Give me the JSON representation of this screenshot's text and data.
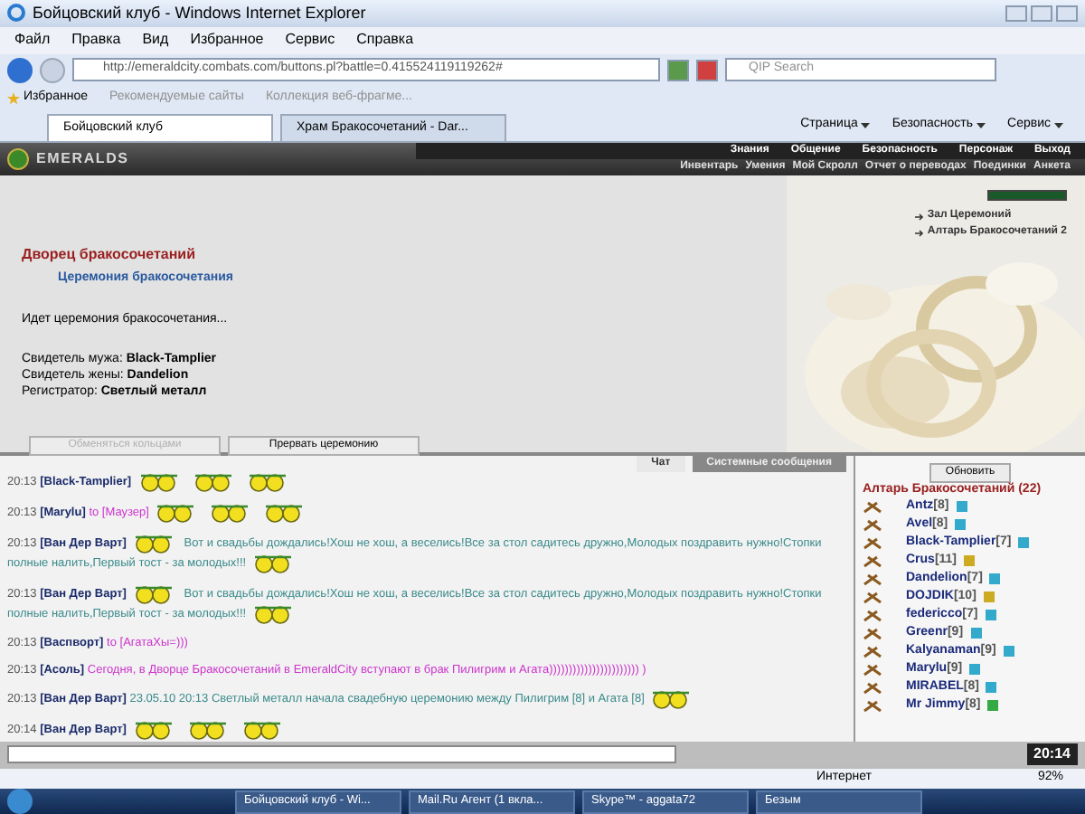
{
  "window": {
    "title": "Бойцовский клуб - Windows Internet Explorer"
  },
  "menu": [
    "Файл",
    "Правка",
    "Вид",
    "Избранное",
    "Сервис",
    "Справка"
  ],
  "address": {
    "value": "http://emeraldcity.combats.com/buttons.pl?battle=0.415524119119262#"
  },
  "search": {
    "placeholder": "QIP Search"
  },
  "favorites": {
    "label": "Избранное",
    "links": [
      "Рекомендуемые сайты",
      "Коллекция веб-фрагме..."
    ]
  },
  "tabs": [
    {
      "label": "Бойцовский клуб",
      "selected": true
    },
    {
      "label": "Храм Бракосочетаний - Dar...",
      "selected": false
    }
  ],
  "command_bar": [
    "Страница",
    "Безопасность",
    "Сервис"
  ],
  "game": {
    "logo": "EMERALDS",
    "nav_top": [
      "Знания",
      "Общение",
      "Безопасность",
      "Персонаж",
      "Выход"
    ],
    "nav_bottom": [
      "Инвентарь",
      "Умения",
      "Мой Скролл",
      "Отчет о переводах",
      "Поединки",
      "Анкета"
    ],
    "title": "Дворец бракосочетаний",
    "subtitle": "Церемония бракосочетания",
    "status": "Идет церемония бракосочетания...",
    "fields": [
      {
        "label": "Свидетель мужа:",
        "value": "Black-Tamplier"
      },
      {
        "label": "Свидетель жены:",
        "value": "Dandelion"
      },
      {
        "label": "Регистратор:",
        "value": "Светлый металл"
      }
    ],
    "buttons": [
      {
        "label": "Обменяться кольцами",
        "disabled": true
      },
      {
        "label": "Прервать церемонию",
        "disabled": false
      }
    ],
    "links": [
      "Зал Церемоний",
      "Алтарь Бракосочетаний 2"
    ]
  },
  "chat": {
    "tabs": [
      {
        "label": "Чат",
        "selected": true
      },
      {
        "label": "Системные сообщения",
        "selected": false
      }
    ],
    "messages": [
      {
        "time": "20:13",
        "from": "[Black-Tamplier]",
        "parts": [
          {
            "kind": "smiley"
          },
          {
            "kind": "smiley"
          },
          {
            "kind": "smiley"
          }
        ]
      },
      {
        "time": "20:13",
        "from": "[Marylu]",
        "to": "to [Маузер]",
        "parts": [
          {
            "kind": "smiley"
          },
          {
            "kind": "smiley"
          },
          {
            "kind": "smiley"
          }
        ]
      },
      {
        "time": "20:13",
        "from": "[Ван Дер Варт]",
        "parts": [
          {
            "kind": "smiley"
          },
          {
            "kind": "text",
            "text": "Вот и свадьбы дождались!Хош не хош, а веселись!Все за стол садитесь дружно,Молодых поздравить нужно!Стопки полные налить,Первый тост - за молодых!!!"
          },
          {
            "kind": "smiley"
          }
        ]
      },
      {
        "time": "20:13",
        "from": "[Ван Дер Варт]",
        "parts": [
          {
            "kind": "smiley"
          },
          {
            "kind": "text",
            "text": "Вот и свадьбы дождались!Хош не хош, а веселись!Все за стол садитесь дружно,Молодых поздравить нужно!Стопки полные налить,Первый тост - за молодых!!!"
          },
          {
            "kind": "smiley"
          }
        ]
      },
      {
        "time": "20:13",
        "from": "[Васпворт]",
        "to": "to [АгатаХы=)))"
      },
      {
        "time": "20:13",
        "from": "[Асоль]",
        "parts": [
          {
            "kind": "magenta",
            "text": "Сегодня, в Дворце Бракосочетаний в EmeraldCity вступают в брак Пилигрим и Агата))))))))))))))))))))))) )"
          }
        ]
      },
      {
        "time": "20:13",
        "from": "[Ван Дер Варт]",
        "parts": [
          {
            "kind": "text",
            "text": "23.05.10 20:13 Светлый металл начала свадебную церемонию между Пилигрим [8] и Агата [8]"
          },
          {
            "kind": "smiley"
          }
        ]
      },
      {
        "time": "20:14",
        "from": "[Ван Дер Варт]",
        "parts": [
          {
            "kind": "smiley"
          },
          {
            "kind": "smiley"
          },
          {
            "kind": "smiley"
          }
        ]
      }
    ]
  },
  "room": {
    "refresh": "Обновить",
    "title": "Алтарь Бракосочетаний (22)",
    "players": [
      {
        "name": "Antz",
        "level": "[8]",
        "color": "#33aacc"
      },
      {
        "name": "Avel",
        "level": "[8]",
        "color": "#33aacc"
      },
      {
        "name": "Black-Tamplier",
        "level": "[7]",
        "color": "#33aacc"
      },
      {
        "name": "Crus",
        "level": "[11]",
        "color": "#ccaa22"
      },
      {
        "name": "Dandelion",
        "level": "[7]",
        "color": "#33aacc"
      },
      {
        "name": "DOJDIK",
        "level": "[10]",
        "color": "#ccaa22"
      },
      {
        "name": "federicco",
        "level": "[7]",
        "color": "#33aacc"
      },
      {
        "name": "Greenr",
        "level": "[9]",
        "color": "#33aacc"
      },
      {
        "name": "Kalyanaman",
        "level": "[9]",
        "color": "#33aacc"
      },
      {
        "name": "Marylu",
        "level": "[9]",
        "color": "#33aacc"
      },
      {
        "name": "MIRABEL",
        "level": "[8]",
        "color": "#33aacc"
      },
      {
        "name": "Mr Jimmy",
        "level": "[8]",
        "color": "#33aa44"
      }
    ]
  },
  "clock": "20:14",
  "status_bar": {
    "zone": "Интернет",
    "zoom": "92%"
  },
  "taskbar": [
    "Бойцовский клуб - Wi...",
    "Mail.Ru Агент (1 вкла...",
    "Skype™ - aggata72",
    "Безым"
  ]
}
